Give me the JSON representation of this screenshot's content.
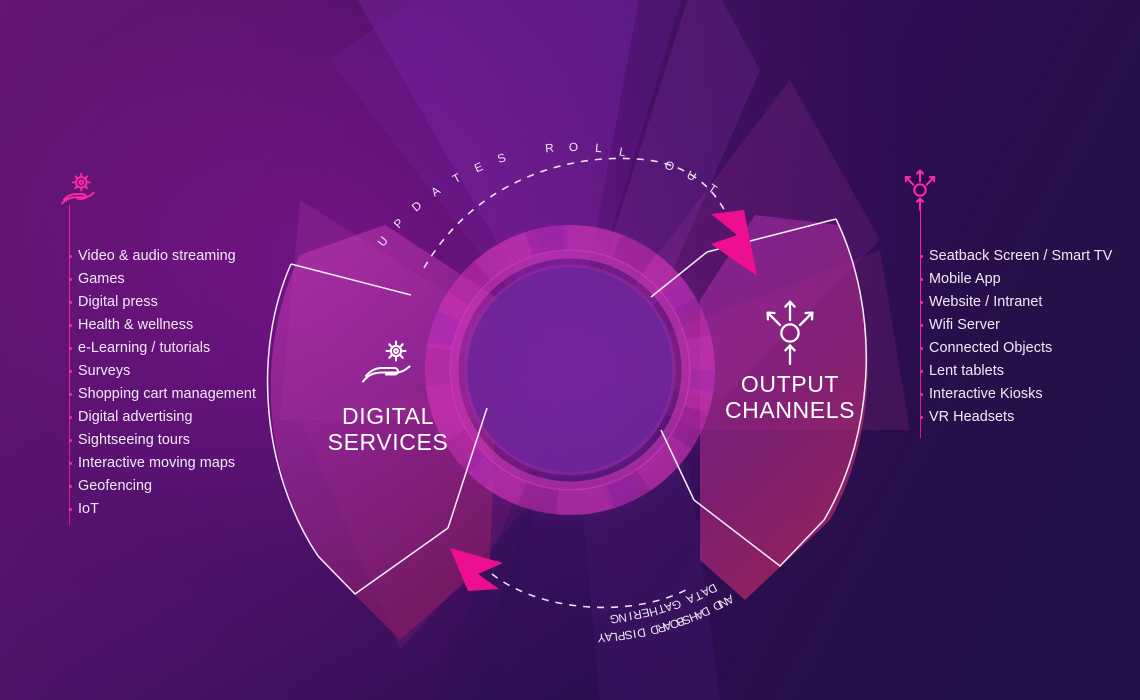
{
  "diagram": {
    "title_left": "DIGITAL\nSERVICES",
    "flow_labels": {
      "top": "UPDATES ROLL OUT",
      "bottom_line1": "DATA GATHERING",
      "bottom_line2": "AND DAHSBOARD DISPLAY"
    },
    "colors": {
      "accent_pink": "#ff1f9c",
      "arrow_magenta": "#ee0f91",
      "outline_white": "#ffffff",
      "bg_top_left": "#61176f",
      "bg_bottom_right": "#22104a",
      "ring_inner": "#6a2496",
      "ring_mid": "#d42bb0",
      "text": "#f2e9f6"
    }
  },
  "left_panel": {
    "icon": "gear-in-hand-icon",
    "caption_line1": "DIGITAL",
    "caption_line2": "SERVICES",
    "items": [
      "Video & audio streaming",
      "Games",
      "Digital press",
      "Health & wellness",
      "e-Learning / tutorials",
      "Surveys",
      "Shopping cart management",
      "Digital advertising",
      "Sightseeing tours",
      "Interactive moving maps",
      "Geofencing",
      "IoT"
    ]
  },
  "right_panel": {
    "icon": "broadcast-distribution-icon",
    "caption_line1": "OUTPUT",
    "caption_line2": "CHANNELS",
    "items": [
      "Seatback Screen / Smart TV",
      "Mobile App",
      "Website / Intranet",
      "Wifi Server",
      "Connected Objects",
      "Lent tablets",
      "Interactive Kiosks",
      "VR Headsets"
    ]
  },
  "arc_chars": {
    "top": [
      "U",
      "P",
      "D",
      "A",
      "T",
      "E",
      "S",
      " ",
      "R",
      "O",
      "L",
      "L",
      " ",
      "O",
      "U",
      "T"
    ],
    "bottom1": [
      "D",
      "A",
      "T",
      "A",
      " ",
      "G",
      "A",
      "T",
      "H",
      "E",
      "R",
      "I",
      "N",
      "G"
    ],
    "bottom2": [
      "A",
      "N",
      "D",
      " ",
      "D",
      "A",
      "H",
      "S",
      "B",
      "O",
      "A",
      "R",
      "D",
      " ",
      "D",
      "I",
      "S",
      "P",
      "L",
      "A",
      "Y"
    ]
  }
}
